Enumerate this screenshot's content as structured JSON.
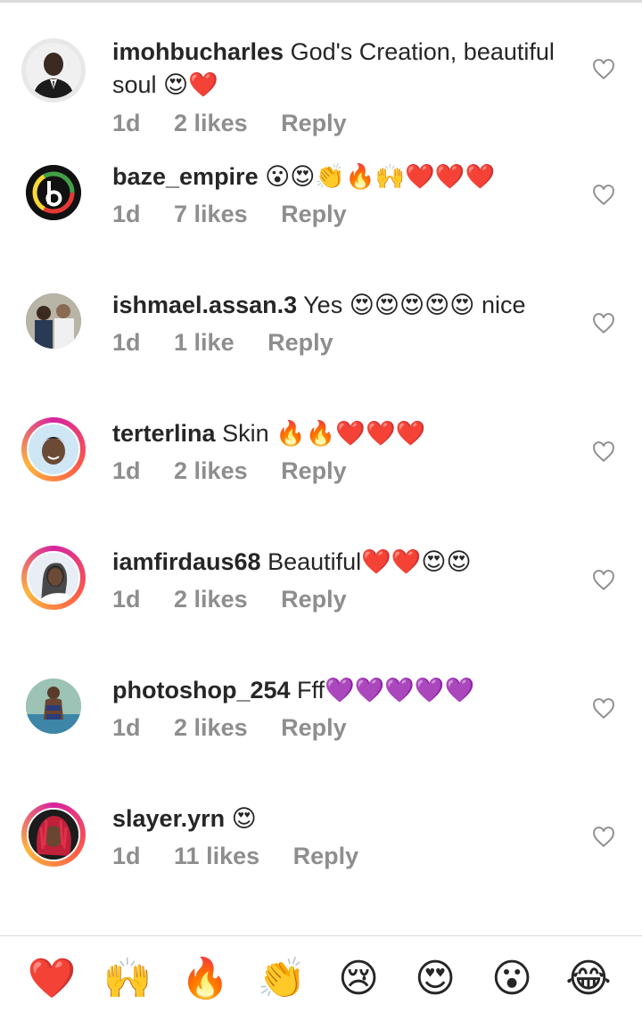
{
  "comments": [
    {
      "user": "imohbucharles",
      "text": "God's Creation, beautiful soul",
      "emoji": "😍❤️",
      "time": "1d",
      "likes": "2 likes",
      "reply": "Reply"
    },
    {
      "user": "baze_empire",
      "text": "",
      "emoji": "😮😍👏🔥🙌❤️❤️❤️",
      "time": "1d",
      "likes": "7 likes",
      "reply": "Reply"
    },
    {
      "user": "ishmael.assan.3",
      "text": "Yes",
      "emoji": "😍😍😍😍😍",
      "suffix": "nice",
      "time": "1d",
      "likes": "1 like",
      "reply": "Reply"
    },
    {
      "user": "terterlina",
      "text": "Skin",
      "emoji": "🔥🔥❤️❤️❤️",
      "time": "1d",
      "likes": "2 likes",
      "reply": "Reply"
    },
    {
      "user": "iamfirdaus68",
      "text": "Beautiful",
      "emoji": "❤️❤️😍😍",
      "time": "1d",
      "likes": "2 likes",
      "reply": "Reply"
    },
    {
      "user": "photoshop_254",
      "text": "Fff",
      "emoji": "💜💜💜💜💜",
      "time": "1d",
      "likes": "2 likes",
      "reply": "Reply"
    },
    {
      "user": "slayer.yrn",
      "text": "",
      "emoji": "😍",
      "time": "1d",
      "likes": "11 likes",
      "reply": "Reply"
    }
  ],
  "quick_reactions": [
    "❤️",
    "🙌",
    "🔥",
    "👏",
    "😢",
    "😍",
    "😮",
    "😂"
  ],
  "colors": {
    "text": "#262626",
    "muted": "#8e8e8e",
    "divider": "#dbdbdb",
    "heart": "#ed4956",
    "purple": "#8a2be2"
  }
}
